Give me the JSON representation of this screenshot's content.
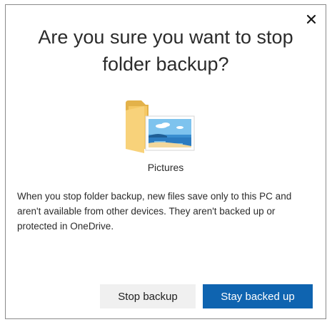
{
  "dialog": {
    "title": "Are you sure you want to stop folder backup?",
    "folder": {
      "label": "Pictures",
      "icon": "pictures-folder-icon"
    },
    "message": "When you stop folder backup, new files save only to this PC and aren't available from other devices. They aren't backed up or protected in OneDrive.",
    "buttons": {
      "stop": "Stop backup",
      "stay": "Stay backed up"
    },
    "close_icon": "close-icon",
    "colors": {
      "primary_button": "#0f64b0",
      "secondary_button": "#f0f0f0",
      "folder_yellow": "#f5c864"
    }
  }
}
